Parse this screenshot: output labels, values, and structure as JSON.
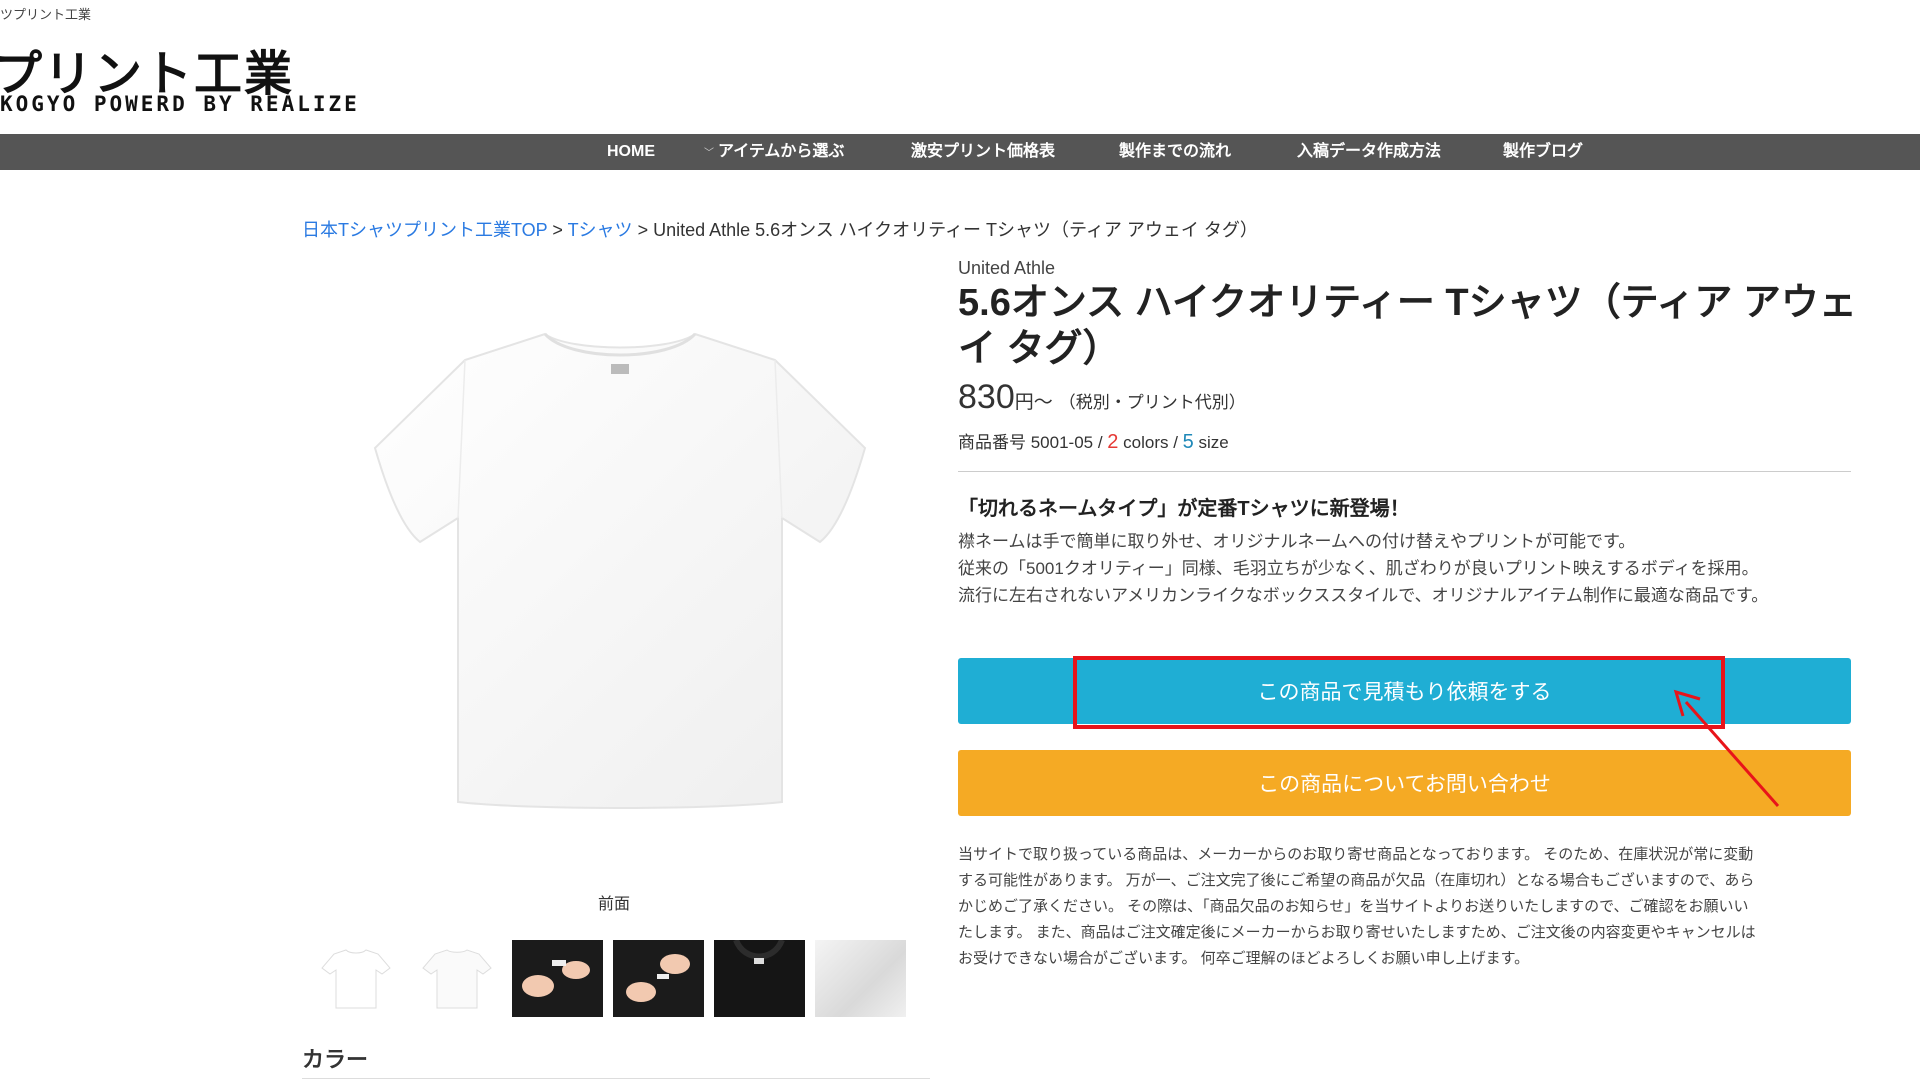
{
  "header": {
    "tagline": "ツプリント工業",
    "logo_main": "プリント工業",
    "logo_sub": "KOGYO POWERD BY REALIZE"
  },
  "nav": {
    "items": [
      {
        "label": "HOME"
      },
      {
        "label": "アイテムから選ぶ",
        "has_dropdown": true
      },
      {
        "label": "激安プリント価格表"
      },
      {
        "label": "製作までの流れ"
      },
      {
        "label": "入稿データ作成方法"
      },
      {
        "label": "製作ブログ"
      }
    ]
  },
  "breadcrumb": {
    "home": "日本Tシャツプリント工業TOP",
    "sep1": " > ",
    "category": "Tシャツ",
    "sep2": " > ",
    "current": "United Athle 5.6オンス ハイクオリティー Tシャツ（ティア アウェイ タグ）"
  },
  "gallery": {
    "view_label": "前面",
    "thumbnails": [
      "white-tshirt-front",
      "white-tshirt-back",
      "hands-on-black-fabric",
      "hands-on-black-fabric",
      "black-tshirt-collar",
      "white-fabric-closeup"
    ]
  },
  "color_section": {
    "heading": "カラー"
  },
  "product": {
    "brand": "United Athle",
    "title": "5.6オンス ハイクオリティー Tシャツ（ティア アウェイ タグ）",
    "price": "830",
    "price_unit": "円～",
    "price_note": "（税別・プリント代別）",
    "code_label": "商品番号 5001-05 / ",
    "colors_count": "2",
    "colors_label": " colors / ",
    "size_count": "5",
    "size_label": " size"
  },
  "feature": {
    "heading": "「切れるネームタイプ」が定番Tシャツに新登場！",
    "lines": [
      "襟ネームは手で簡単に取り外せ、オリジナルネームへの付け替えやプリントが可能です。",
      "従来の「5001クオリティー」同様、毛羽立ちが少なく、肌ざわりが良いプリント映えするボディを採用。",
      "流行に左右されないアメリカンライクなボックススタイルで、オリジナルアイテム制作に最適な商品です。"
    ]
  },
  "buttons": {
    "quote_label": "この商品で見積もり依頼をする",
    "inquiry_label": "この商品についてお問い合わせ"
  },
  "disclaimer": {
    "lines": [
      "当サイトで取り扱っている商品は、メーカーからのお取り寄せ商品となっております。 そのため、在庫状況が常に変動",
      "する可能性があります。 万が一、ご注文完了後にご希望の商品が欠品（在庫切れ）となる場合もございますので、あら",
      "かじめご了承ください。 その際は、「商品欠品のお知らせ」を当サイトよりお送りいたしますので、ご確認をお願いい",
      "たします。 また、商品はご注文確定後にメーカーからお取り寄せいたしますため、ご注文後の内容変更やキャンセルは",
      "お受けできない場合がございます。 何卒ご理解のほどよろしくお願い申し上げます。"
    ]
  },
  "colors": {
    "nav_bg": "#555555",
    "link": "#2a7ae2",
    "quote_button": "#1faed4",
    "inquiry_button": "#f5aa24",
    "annotation": "#e8141a"
  }
}
